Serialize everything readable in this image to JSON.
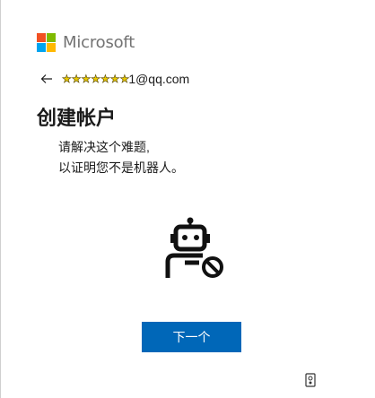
{
  "brand": {
    "name": "Microsoft",
    "colors": [
      "#f25022",
      "#7fba00",
      "#00a4ef",
      "#ffb900"
    ]
  },
  "identity": {
    "masked_prefix": "★★★★★★★",
    "email_suffix": "1@qq.com"
  },
  "page": {
    "title": "创建帐户",
    "description_line1": "请解决这个难题,",
    "description_line2": "以证明您不是机器人。"
  },
  "illustration": {
    "icon": "robot-blocked-icon"
  },
  "actions": {
    "next_label": "下一个"
  },
  "footer": {
    "icon": "audio-challenge-icon"
  },
  "theme": {
    "accent": "#0067b8"
  }
}
